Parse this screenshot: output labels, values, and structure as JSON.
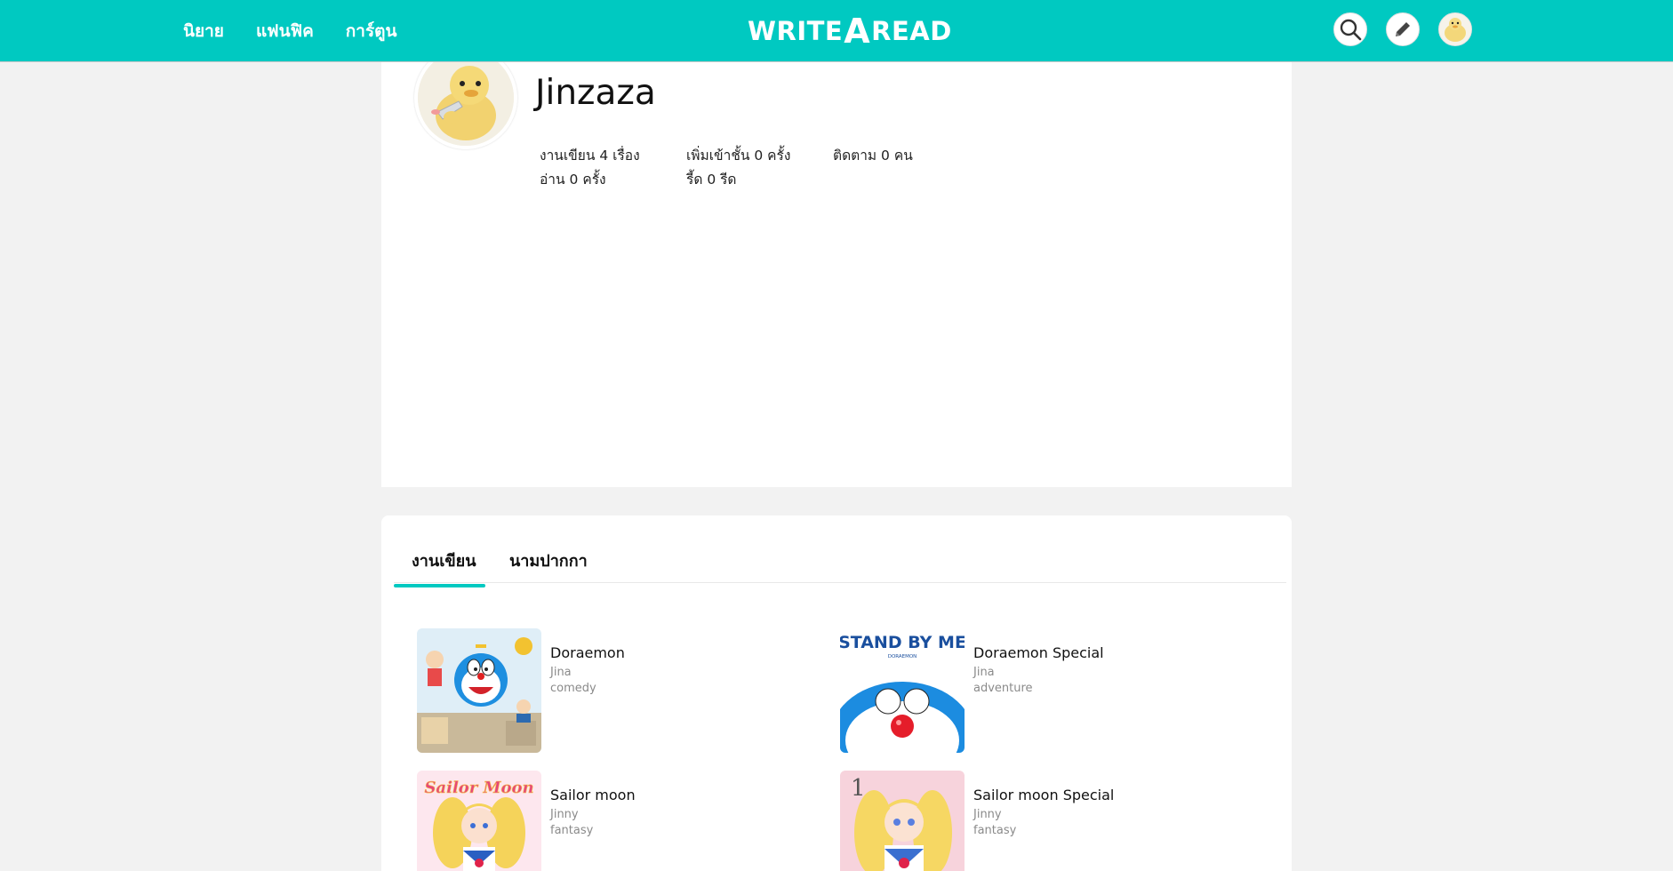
{
  "nav": {
    "links": [
      "นิยาย",
      "แฟนฟิค",
      "การ์ตูน"
    ],
    "logo_left": "WRITE",
    "logo_mid": "A",
    "logo_right": "READ",
    "icons": [
      "search-icon",
      "pencil-icon",
      "avatar"
    ],
    "brand_color": "#00c9c1"
  },
  "profile": {
    "name": "Jinzaza",
    "stats": {
      "works": "งานเขียน 4 เรื่อง",
      "reads": "อ่าน 0 ครั้ง",
      "shelf_adds": "เพิ่มเข้าชั้น 0 ครั้ง",
      "reeds": "รี้ด 0 รีด",
      "followers": "ติดตาม 0 คน"
    }
  },
  "tabs": [
    "งานเขียน",
    "นามปากกา"
  ],
  "stories": [
    {
      "title": "Doraemon",
      "author": "Jina",
      "genre": "comedy"
    },
    {
      "title": "Doraemon Special",
      "author": "Jina",
      "genre": "adventure",
      "cover_text": "STAND BY ME",
      "cover_subtext": "DORAEMON"
    },
    {
      "title": "Sailor moon",
      "author": "Jinny",
      "genre": "fantasy",
      "cover_text": "Sailor Moon"
    },
    {
      "title": "Sailor moon Special",
      "author": "Jinny",
      "genre": "fantasy",
      "cover_badge": "1"
    }
  ]
}
